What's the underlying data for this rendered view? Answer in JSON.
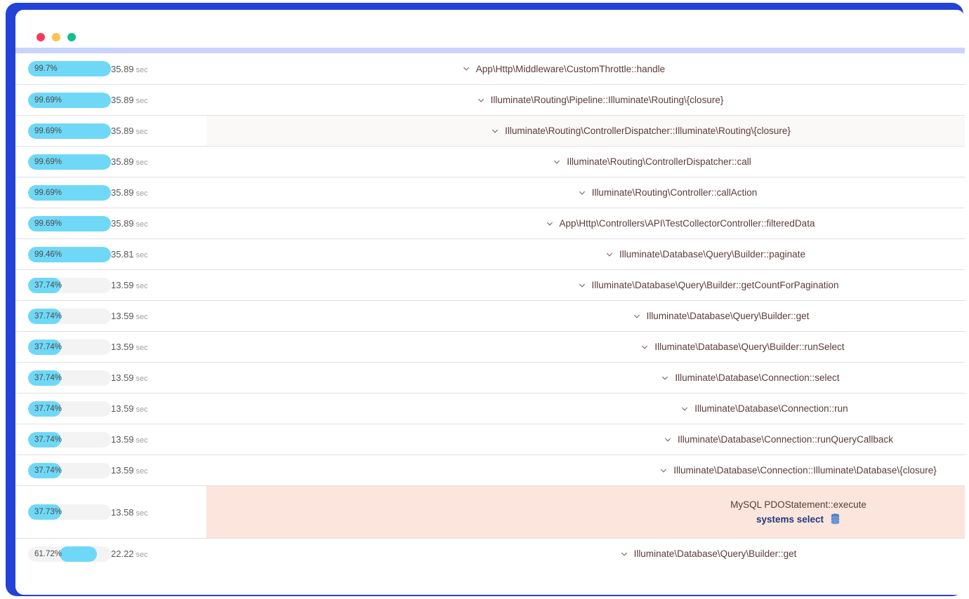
{
  "window": {
    "traffic_lights": [
      {
        "name": "close-button",
        "color": "#fa3a5c"
      },
      {
        "name": "minimize-button",
        "color": "#fcc250"
      },
      {
        "name": "maximize-button",
        "color": "#12c08b"
      }
    ],
    "frame_color": "#2342d8",
    "accent_color": "#6fd8f6"
  },
  "profiler": {
    "unit_label": "sec",
    "rows": [
      {
        "percent": "99.7%",
        "fill": 100,
        "offset": 0,
        "time": "35.89",
        "unit": "sec",
        "label": "App\\Http\\Middleware\\CustomThrottle::handle",
        "depth": 0,
        "shade": "none",
        "type": "frame"
      },
      {
        "percent": "99.69%",
        "fill": 100,
        "offset": 0,
        "time": "35.89",
        "unit": "sec",
        "label": "Illuminate\\Routing\\Pipeline::Illuminate\\Routing\\{closure}",
        "depth": 1,
        "shade": "none",
        "type": "frame"
      },
      {
        "percent": "99.69%",
        "fill": 100,
        "offset": 0,
        "time": "35.89",
        "unit": "sec",
        "label": "Illuminate\\Routing\\ControllerDispatcher::Illuminate\\Routing\\{closure}",
        "depth": 2,
        "shade": "grey",
        "type": "frame"
      },
      {
        "percent": "99.69%",
        "fill": 100,
        "offset": 0,
        "time": "35.89",
        "unit": "sec",
        "label": "Illuminate\\Routing\\ControllerDispatcher::call",
        "depth": 3,
        "shade": "none",
        "type": "frame"
      },
      {
        "percent": "99.69%",
        "fill": 100,
        "offset": 0,
        "time": "35.89",
        "unit": "sec",
        "label": "Illuminate\\Routing\\Controller::callAction",
        "depth": 4,
        "shade": "none",
        "type": "frame"
      },
      {
        "percent": "99.69%",
        "fill": 100,
        "offset": 0,
        "time": "35.89",
        "unit": "sec",
        "label": "App\\Http\\Controllers\\API\\TestCollectorController::filteredData",
        "depth": 5,
        "shade": "none",
        "type": "frame"
      },
      {
        "percent": "99.46%",
        "fill": 100,
        "offset": 0,
        "time": "35.81",
        "unit": "sec",
        "label": "Illuminate\\Database\\Query\\Builder::paginate",
        "depth": 6,
        "shade": "none",
        "type": "frame"
      },
      {
        "percent": "37.74%",
        "fill": 40,
        "offset": 0,
        "time": "13.59",
        "unit": "sec",
        "label": "Illuminate\\Database\\Query\\Builder::getCountForPagination",
        "depth": 7,
        "shade": "none",
        "type": "frame"
      },
      {
        "percent": "37.74%",
        "fill": 40,
        "offset": 0,
        "time": "13.59",
        "unit": "sec",
        "label": "Illuminate\\Database\\Query\\Builder::get",
        "depth": 8,
        "shade": "none",
        "type": "frame"
      },
      {
        "percent": "37.74%",
        "fill": 40,
        "offset": 0,
        "time": "13.59",
        "unit": "sec",
        "label": "Illuminate\\Database\\Query\\Builder::runSelect",
        "depth": 9,
        "shade": "none",
        "type": "frame"
      },
      {
        "percent": "37.74%",
        "fill": 40,
        "offset": 0,
        "time": "13.59",
        "unit": "sec",
        "label": "Illuminate\\Database\\Connection::select",
        "depth": 10,
        "shade": "none",
        "type": "frame"
      },
      {
        "percent": "37.74%",
        "fill": 40,
        "offset": 0,
        "time": "13.59",
        "unit": "sec",
        "label": "Illuminate\\Database\\Connection::run",
        "depth": 11,
        "shade": "none",
        "type": "frame"
      },
      {
        "percent": "37.74%",
        "fill": 40,
        "offset": 0,
        "time": "13.59",
        "unit": "sec",
        "label": "Illuminate\\Database\\Connection::runQueryCallback",
        "depth": 12,
        "shade": "none",
        "type": "frame"
      },
      {
        "percent": "37.74%",
        "fill": 40,
        "offset": 0,
        "time": "13.59",
        "unit": "sec",
        "label": "Illuminate\\Database\\Connection::Illuminate\\Database\\{closure}",
        "depth": 13,
        "shade": "none",
        "type": "frame"
      },
      {
        "percent": "37.73%",
        "fill": 40,
        "offset": 0,
        "time": "13.58",
        "unit": "sec",
        "label": "MySQL PDOStatement::execute",
        "sublabel": "systems select",
        "icon": "database-icon",
        "depth": 13,
        "shade": "pink",
        "type": "query"
      },
      {
        "percent": "61.72%",
        "fill": 45,
        "offset": 38,
        "time": "22.22",
        "unit": "sec",
        "label": "Illuminate\\Database\\Query\\Builder::get",
        "depth": 14,
        "shade": "none",
        "type": "frame"
      }
    ]
  }
}
